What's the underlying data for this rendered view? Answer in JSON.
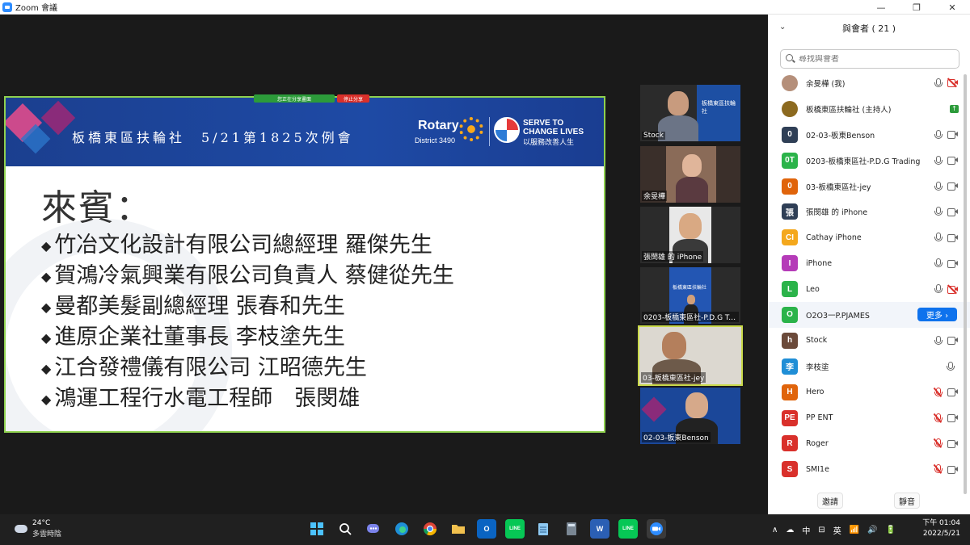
{
  "window": {
    "title": "Zoom 會議",
    "minimize": "—",
    "maximize": "❐",
    "close": "✕"
  },
  "share_toolbar": {
    "stop_label": "停止分享",
    "status_label": "您正在分享畫面"
  },
  "slide": {
    "header_title": "板橋東區扶輪社　5/21第1825次例會",
    "rotary": "Rotary",
    "district": "District 3490",
    "slogan_line1": "SERVE TO",
    "slogan_line2": "CHANGE LIVES",
    "slogan_line3": "以服務改善人生",
    "heading": "來賓：",
    "guests": [
      "竹冶文化設計有限公司總經理 羅傑先生",
      "賀鴻冷氣興業有限公司負責人 蔡健從先生",
      "曼都美髮副總經理 張春和先生",
      "進原企業社董事長 李枝塗先生",
      "江合發禮儀有限公司 江昭德先生",
      "鴻運工程行水電工程師　張閔雄"
    ]
  },
  "thumbnails": [
    {
      "label": "Stock"
    },
    {
      "label": "余旻樺"
    },
    {
      "label": "張閔雄 的 iPhone"
    },
    {
      "label": "0203-板橋東區社-P.D.G Tr..."
    },
    {
      "label": "03-板橋東區社-jey"
    },
    {
      "label": "02-03-板東Benson"
    }
  ],
  "thumb_overlay": {
    "club_small": "板橋東區扶輪社"
  },
  "participants_panel": {
    "title": "與會者 ( 21 )",
    "collapse_icon": "⌄",
    "search_placeholder": "尋找與會者",
    "more_label": "更多 ›",
    "invite_label": "邀請",
    "mute_all_label": "靜音",
    "items": [
      {
        "avatar": "",
        "name": "余旻樺 (我)",
        "color": "#b58f7a"
      },
      {
        "avatar": "",
        "name": "板橋東區扶輪社 (主持人)",
        "color": "#8c6a20"
      },
      {
        "avatar": "0",
        "name": "02-03-板東Benson",
        "color": "#2f3f56"
      },
      {
        "avatar": "0T",
        "name": "0203-板橋東區社-P.D.G Trading",
        "color": "#2bb34a"
      },
      {
        "avatar": "0",
        "name": "03-板橋東區社-jey",
        "color": "#e0640b"
      },
      {
        "avatar": "張",
        "name": "張閔雄 的 iPhone",
        "color": "#2f3f56"
      },
      {
        "avatar": "CI",
        "name": "Cathay iPhone",
        "color": "#f4a81d"
      },
      {
        "avatar": "I",
        "name": "iPhone",
        "color": "#b53bb8"
      },
      {
        "avatar": "L",
        "name": "Leo",
        "color": "#2bb34a"
      },
      {
        "avatar": "O",
        "name": "O2O3一P.PJAMES",
        "color": "#2bb34a"
      },
      {
        "avatar": "h",
        "name": "Stock",
        "color": "#6b4a3a"
      },
      {
        "avatar": "李",
        "name": "李枝塗",
        "color": "#1f8ed6"
      },
      {
        "avatar": "H",
        "name": "Hero",
        "color": "#e0640b"
      },
      {
        "avatar": "PE",
        "name": "PP ENT",
        "color": "#d9302b"
      },
      {
        "avatar": "R",
        "name": "Roger",
        "color": "#d9302b"
      },
      {
        "avatar": "S",
        "name": "SMI1e",
        "color": "#d9302b"
      }
    ]
  },
  "taskbar": {
    "temperature": "24°C",
    "weather": "多雲時陰",
    "time": "下午 01:04",
    "date": "2022/5/21",
    "tray_caret": "∧",
    "tray_ime1": "中",
    "tray_ime2": "英",
    "tray_extra": "⊟",
    "icon_word": "W",
    "icon_outlook": "O",
    "icon_line": "LINE"
  }
}
